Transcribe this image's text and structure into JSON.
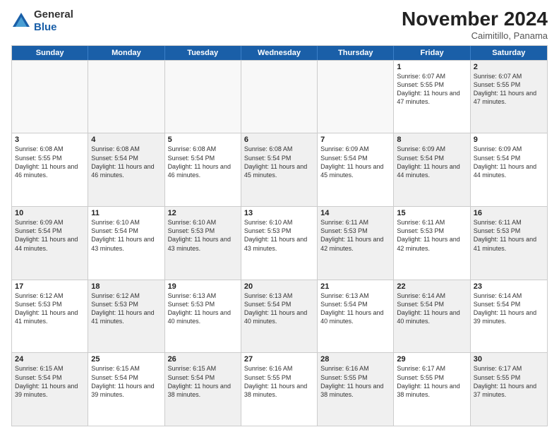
{
  "logo": {
    "general": "General",
    "blue": "Blue"
  },
  "header": {
    "month": "November 2024",
    "location": "Caimitillo, Panama"
  },
  "days_of_week": [
    "Sunday",
    "Monday",
    "Tuesday",
    "Wednesday",
    "Thursday",
    "Friday",
    "Saturday"
  ],
  "weeks": [
    [
      {
        "day": "",
        "info": "",
        "empty": true
      },
      {
        "day": "",
        "info": "",
        "empty": true
      },
      {
        "day": "",
        "info": "",
        "empty": true
      },
      {
        "day": "",
        "info": "",
        "empty": true
      },
      {
        "day": "",
        "info": "",
        "empty": true
      },
      {
        "day": "1",
        "info": "Sunrise: 6:07 AM\nSunset: 5:55 PM\nDaylight: 11 hours and 47 minutes.",
        "empty": false
      },
      {
        "day": "2",
        "info": "Sunrise: 6:07 AM\nSunset: 5:55 PM\nDaylight: 11 hours and 47 minutes.",
        "empty": false,
        "shaded": true
      }
    ],
    [
      {
        "day": "3",
        "info": "Sunrise: 6:08 AM\nSunset: 5:55 PM\nDaylight: 11 hours and 46 minutes.",
        "empty": false
      },
      {
        "day": "4",
        "info": "Sunrise: 6:08 AM\nSunset: 5:54 PM\nDaylight: 11 hours and 46 minutes.",
        "empty": false,
        "shaded": true
      },
      {
        "day": "5",
        "info": "Sunrise: 6:08 AM\nSunset: 5:54 PM\nDaylight: 11 hours and 46 minutes.",
        "empty": false
      },
      {
        "day": "6",
        "info": "Sunrise: 6:08 AM\nSunset: 5:54 PM\nDaylight: 11 hours and 45 minutes.",
        "empty": false,
        "shaded": true
      },
      {
        "day": "7",
        "info": "Sunrise: 6:09 AM\nSunset: 5:54 PM\nDaylight: 11 hours and 45 minutes.",
        "empty": false
      },
      {
        "day": "8",
        "info": "Sunrise: 6:09 AM\nSunset: 5:54 PM\nDaylight: 11 hours and 44 minutes.",
        "empty": false,
        "shaded": true
      },
      {
        "day": "9",
        "info": "Sunrise: 6:09 AM\nSunset: 5:54 PM\nDaylight: 11 hours and 44 minutes.",
        "empty": false
      }
    ],
    [
      {
        "day": "10",
        "info": "Sunrise: 6:09 AM\nSunset: 5:54 PM\nDaylight: 11 hours and 44 minutes.",
        "empty": false,
        "shaded": true
      },
      {
        "day": "11",
        "info": "Sunrise: 6:10 AM\nSunset: 5:54 PM\nDaylight: 11 hours and 43 minutes.",
        "empty": false
      },
      {
        "day": "12",
        "info": "Sunrise: 6:10 AM\nSunset: 5:53 PM\nDaylight: 11 hours and 43 minutes.",
        "empty": false,
        "shaded": true
      },
      {
        "day": "13",
        "info": "Sunrise: 6:10 AM\nSunset: 5:53 PM\nDaylight: 11 hours and 43 minutes.",
        "empty": false
      },
      {
        "day": "14",
        "info": "Sunrise: 6:11 AM\nSunset: 5:53 PM\nDaylight: 11 hours and 42 minutes.",
        "empty": false,
        "shaded": true
      },
      {
        "day": "15",
        "info": "Sunrise: 6:11 AM\nSunset: 5:53 PM\nDaylight: 11 hours and 42 minutes.",
        "empty": false
      },
      {
        "day": "16",
        "info": "Sunrise: 6:11 AM\nSunset: 5:53 PM\nDaylight: 11 hours and 41 minutes.",
        "empty": false,
        "shaded": true
      }
    ],
    [
      {
        "day": "17",
        "info": "Sunrise: 6:12 AM\nSunset: 5:53 PM\nDaylight: 11 hours and 41 minutes.",
        "empty": false
      },
      {
        "day": "18",
        "info": "Sunrise: 6:12 AM\nSunset: 5:53 PM\nDaylight: 11 hours and 41 minutes.",
        "empty": false,
        "shaded": true
      },
      {
        "day": "19",
        "info": "Sunrise: 6:13 AM\nSunset: 5:53 PM\nDaylight: 11 hours and 40 minutes.",
        "empty": false
      },
      {
        "day": "20",
        "info": "Sunrise: 6:13 AM\nSunset: 5:54 PM\nDaylight: 11 hours and 40 minutes.",
        "empty": false,
        "shaded": true
      },
      {
        "day": "21",
        "info": "Sunrise: 6:13 AM\nSunset: 5:54 PM\nDaylight: 11 hours and 40 minutes.",
        "empty": false
      },
      {
        "day": "22",
        "info": "Sunrise: 6:14 AM\nSunset: 5:54 PM\nDaylight: 11 hours and 40 minutes.",
        "empty": false,
        "shaded": true
      },
      {
        "day": "23",
        "info": "Sunrise: 6:14 AM\nSunset: 5:54 PM\nDaylight: 11 hours and 39 minutes.",
        "empty": false
      }
    ],
    [
      {
        "day": "24",
        "info": "Sunrise: 6:15 AM\nSunset: 5:54 PM\nDaylight: 11 hours and 39 minutes.",
        "empty": false,
        "shaded": true
      },
      {
        "day": "25",
        "info": "Sunrise: 6:15 AM\nSunset: 5:54 PM\nDaylight: 11 hours and 39 minutes.",
        "empty": false
      },
      {
        "day": "26",
        "info": "Sunrise: 6:15 AM\nSunset: 5:54 PM\nDaylight: 11 hours and 38 minutes.",
        "empty": false,
        "shaded": true
      },
      {
        "day": "27",
        "info": "Sunrise: 6:16 AM\nSunset: 5:55 PM\nDaylight: 11 hours and 38 minutes.",
        "empty": false
      },
      {
        "day": "28",
        "info": "Sunrise: 6:16 AM\nSunset: 5:55 PM\nDaylight: 11 hours and 38 minutes.",
        "empty": false,
        "shaded": true
      },
      {
        "day": "29",
        "info": "Sunrise: 6:17 AM\nSunset: 5:55 PM\nDaylight: 11 hours and 38 minutes.",
        "empty": false
      },
      {
        "day": "30",
        "info": "Sunrise: 6:17 AM\nSunset: 5:55 PM\nDaylight: 11 hours and 37 minutes.",
        "empty": false,
        "shaded": true
      }
    ]
  ]
}
